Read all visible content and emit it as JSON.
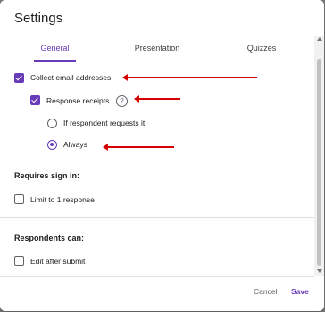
{
  "dialog": {
    "title": "Settings",
    "tabs": [
      {
        "label": "General",
        "active": true
      },
      {
        "label": "Presentation",
        "active": false
      },
      {
        "label": "Quizzes",
        "active": false
      }
    ]
  },
  "general": {
    "collect_email": {
      "label": "Collect email addresses",
      "checked": true
    },
    "response_receipts": {
      "label": "Response receipts",
      "checked": true,
      "help_glyph": "?"
    },
    "receipt_options": [
      {
        "label": "If respondent requests it",
        "selected": false
      },
      {
        "label": "Always",
        "selected": true
      }
    ],
    "requires_sign_in": {
      "heading": "Requires sign in:",
      "limit": {
        "label": "Limit to 1 response",
        "checked": false
      }
    },
    "respondents_can": {
      "heading": "Respondents can:",
      "edit": {
        "label": "Edit after submit",
        "checked": false
      }
    }
  },
  "footer": {
    "cancel_label": "Cancel",
    "save_label": "Save"
  },
  "colors": {
    "accent": "#673ab7",
    "annotation": "#d50000"
  }
}
